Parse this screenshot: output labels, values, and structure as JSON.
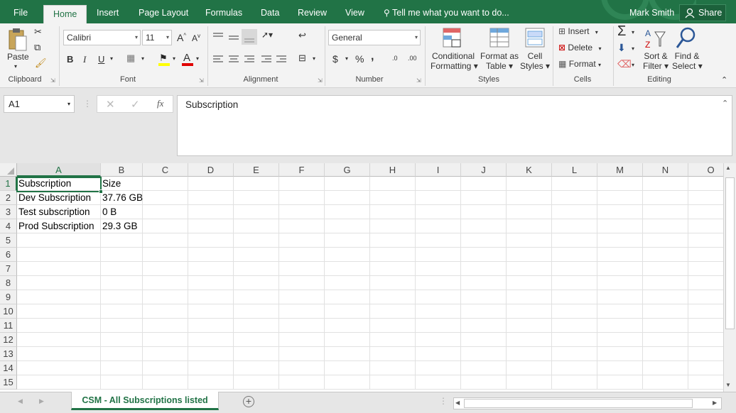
{
  "tabs": {
    "file": "File",
    "home": "Home",
    "insert": "Insert",
    "page_layout": "Page Layout",
    "formulas": "Formulas",
    "data": "Data",
    "review": "Review",
    "view": "View",
    "tell_me": "Tell me what you want to do...",
    "user": "Mark Smith",
    "share": "Share"
  },
  "ribbon": {
    "clipboard": {
      "paste": "Paste",
      "label": "Clipboard"
    },
    "font": {
      "name": "Calibri",
      "size": "11",
      "grow": "A",
      "shrink": "A",
      "bold": "B",
      "italic": "I",
      "underline": "U",
      "font_color": "A",
      "label": "Font"
    },
    "alignment": {
      "label": "Alignment"
    },
    "number": {
      "format": "General",
      "currency": "$",
      "percent": "%",
      "comma": ",",
      "inc_dec": ".00",
      "dec_dec": ".0",
      "label": "Number"
    },
    "styles": {
      "conditional_1": "Conditional",
      "conditional_2": "Formatting",
      "format_table_1": "Format as",
      "format_table_2": "Table",
      "cell_styles_1": "Cell",
      "cell_styles_2": "Styles",
      "label": "Styles"
    },
    "cells": {
      "insert": "Insert",
      "delete": "Delete",
      "format": "Format",
      "label": "Cells"
    },
    "editing": {
      "sort_1": "Sort &",
      "sort_2": "Filter",
      "find_1": "Find &",
      "find_2": "Select",
      "label": "Editing"
    }
  },
  "formula_bar": {
    "name_box": "A1",
    "fx": "fx",
    "content": "Subscription"
  },
  "columns": [
    "A",
    "B",
    "C",
    "D",
    "E",
    "F",
    "G",
    "H",
    "I",
    "J",
    "K",
    "L",
    "M",
    "N",
    "O"
  ],
  "rows": [
    "1",
    "2",
    "3",
    "4",
    "5",
    "6",
    "7",
    "8",
    "9",
    "10",
    "11",
    "12",
    "13",
    "14",
    "15"
  ],
  "cells": [
    [
      "Subscription",
      "Size"
    ],
    [
      "Dev Subscription",
      "37.76 GB"
    ],
    [
      "Test subscription",
      "0 B"
    ],
    [
      "Prod Subscription",
      "29.3 GB"
    ]
  ],
  "sheet": {
    "tab": "CSM - All Subscriptions listed",
    "add": "+"
  },
  "colors": {
    "accent": "#217346"
  }
}
